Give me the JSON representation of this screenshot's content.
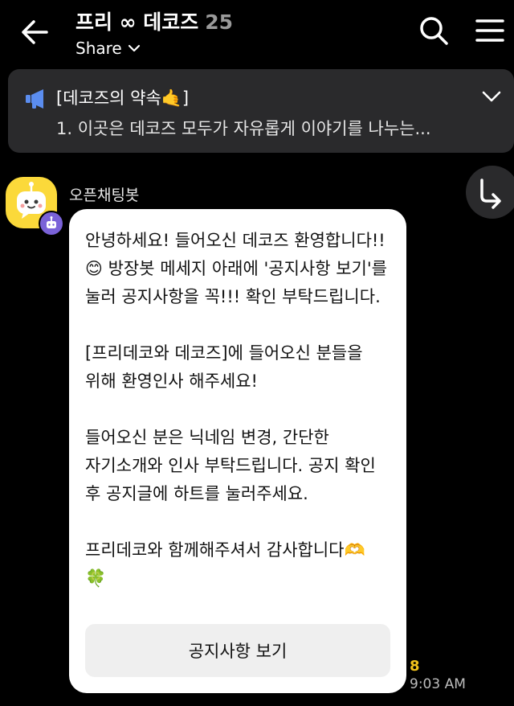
{
  "header": {
    "title": "프리 ∞ 데코즈",
    "member_count": "25",
    "share_label": "Share",
    "icons": [
      "back-arrow-icon",
      "chevron-down-icon",
      "search-icon",
      "hamburger-menu-icon"
    ]
  },
  "notice": {
    "icon": "megaphone-icon",
    "title": "[데코즈의 약속🤙]",
    "preview": "1. 이곳은 데코즈 모두가 자유롭게 이야기를 나누는...",
    "chevron": "chevron-down-icon",
    "accent": "#5b8def"
  },
  "message": {
    "sender": "오픈채팅봇",
    "avatar_icon": "chatbot-avatar-icon",
    "badge_icon": "bot-badge-icon",
    "forward_icon": "forward-arrow-icon",
    "text": "안녕하세요! 들어오신 데코즈 환영합니다!!😊 방장봇 메세지 아래에 '공지사항 보기'를 눌러 공지사항을 꼭!!! 확인 부탁드립니다.\n\n[프리데코와 데코즈]에 들어오신 분들을 위해 환영인사 해주세요!\n\n들어오신 분은 닉네임 변경, 간단한 자기소개와 인사 부탁드립니다. 공지 확인 후 공지글에 하트를 눌러주세요.\n\n프리데코와 함께해주셔서 감사합니다🫶\n🍀",
    "button_label": "공지사항 보기",
    "unread_count": "8",
    "time": "9:03 AM"
  },
  "colors": {
    "background": "#000000",
    "banner": "#2a2a2c",
    "bubble": "#ffffff",
    "unread": "#f2c21b",
    "avatar": "#fbd93a",
    "badge": "#7a62d8"
  }
}
